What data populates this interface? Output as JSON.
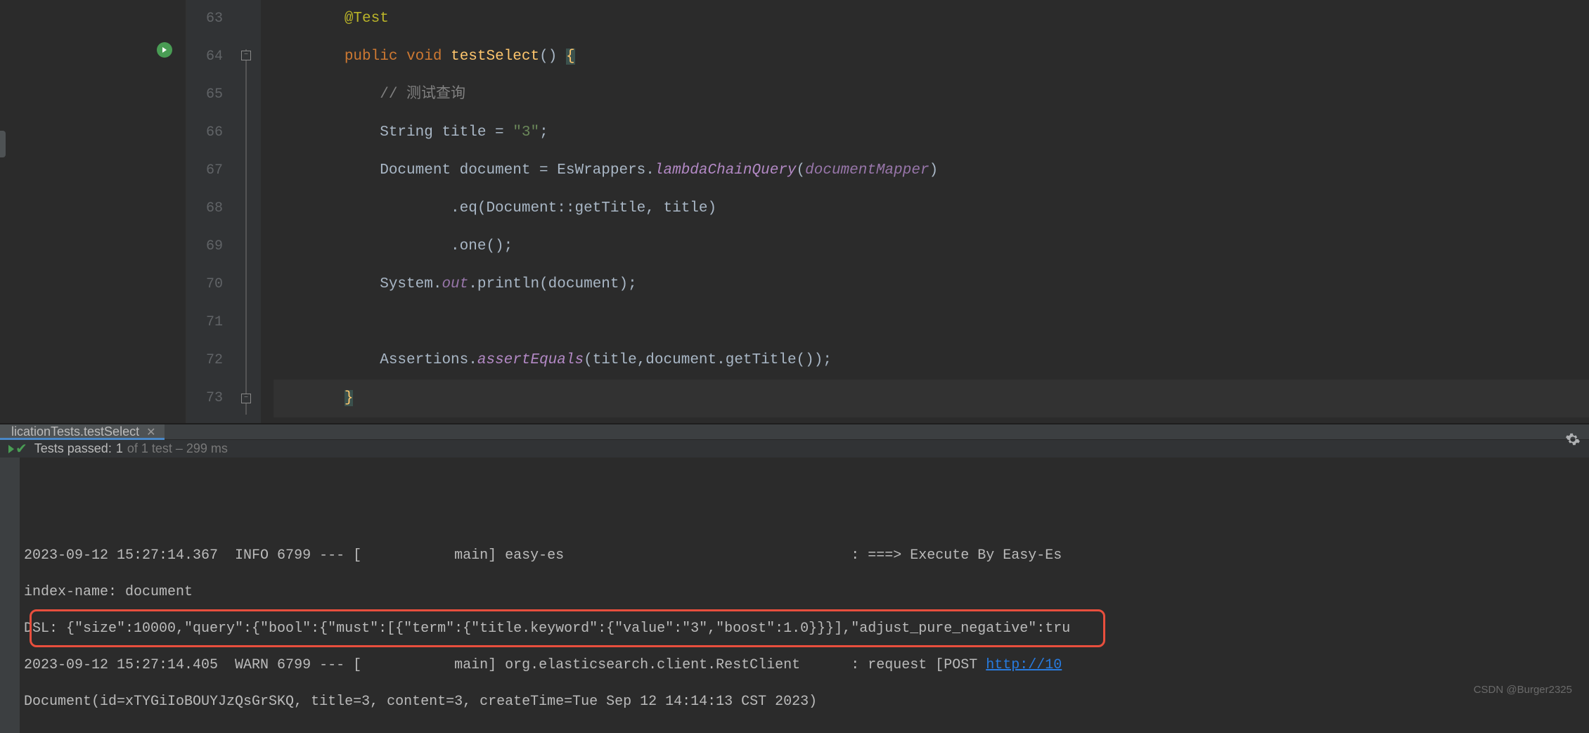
{
  "editor": {
    "line_start": 63,
    "lines": {
      "63": {
        "indent": "        ",
        "tokens": [
          [
            "@Test",
            "kw-annotation"
          ]
        ]
      },
      "64": {
        "indent": "        ",
        "tokens": [
          [
            "public",
            "kw-public"
          ],
          [
            " ",
            ""
          ],
          [
            "void",
            "kw-void"
          ],
          [
            " ",
            ""
          ],
          [
            "testSelect",
            "kw-method"
          ],
          [
            "() ",
            ""
          ],
          [
            "{",
            "brace-hl"
          ]
        ]
      },
      "65": {
        "indent": "            ",
        "tokens": [
          [
            "// 测试查询",
            "kw-comment"
          ]
        ]
      },
      "66": {
        "indent": "            ",
        "tokens": [
          [
            "String title = ",
            ""
          ],
          [
            "\"3\"",
            "kw-string"
          ],
          [
            ";",
            ""
          ]
        ]
      },
      "67": {
        "indent": "            ",
        "tokens": [
          [
            "Document document = EsWrappers.",
            ""
          ],
          [
            "lambdaChainQuery",
            "kw-static-method"
          ],
          [
            "(",
            ""
          ],
          [
            "documentMapper",
            "kw-field"
          ],
          [
            ")",
            ""
          ]
        ]
      },
      "68": {
        "indent": "                    ",
        "tokens": [
          [
            ".eq(Document",
            ""
          ],
          [
            "::",
            ""
          ],
          [
            "getTitle",
            ""
          ],
          [
            ", title)",
            ""
          ]
        ]
      },
      "69": {
        "indent": "                    ",
        "tokens": [
          [
            ".one();",
            ""
          ]
        ]
      },
      "70": {
        "indent": "            ",
        "tokens": [
          [
            "System.",
            ""
          ],
          [
            "out",
            "kw-field"
          ],
          [
            ".println(document);",
            ""
          ]
        ]
      },
      "71": {
        "indent": "",
        "tokens": [
          [
            "",
            ""
          ]
        ]
      },
      "72": {
        "indent": "            ",
        "tokens": [
          [
            "Assertions.",
            ""
          ],
          [
            "assertEquals",
            "kw-static-method"
          ],
          [
            "(title,document.getTitle());",
            ""
          ]
        ]
      },
      "73": {
        "indent": "        ",
        "tokens": [
          [
            "}",
            "brace-hl"
          ]
        ]
      }
    }
  },
  "tab": {
    "label": "licationTests.testSelect"
  },
  "test_status": {
    "label_prefix": "Tests passed:",
    "count": "1",
    "total_suffix": "of 1 test – 299 ms"
  },
  "console": {
    "lines": [
      "2023-09-12 15:27:14.367  INFO 6799 --- [           main] easy-es                                  : ===> Execute By Easy-Es",
      "index-name: document",
      "DSL: {\"size\":10000,\"query\":{\"bool\":{\"must\":[{\"term\":{\"title.keyword\":{\"value\":\"3\",\"boost\":1.0}}}],\"adjust_pure_negative\":tru",
      "2023-09-12 15:27:14.405  WARN 6799 --- [           main] org.elasticsearch.client.RestClient      : request [POST ",
      "Document(id=xTYGiIoBOUYJzQsGrSKQ, title=3, content=3, createTime=Tue Sep 12 14:14:13 CST 2023)"
    ],
    "link_text": "http://10"
  },
  "watermark": "CSDN @Burger2325"
}
